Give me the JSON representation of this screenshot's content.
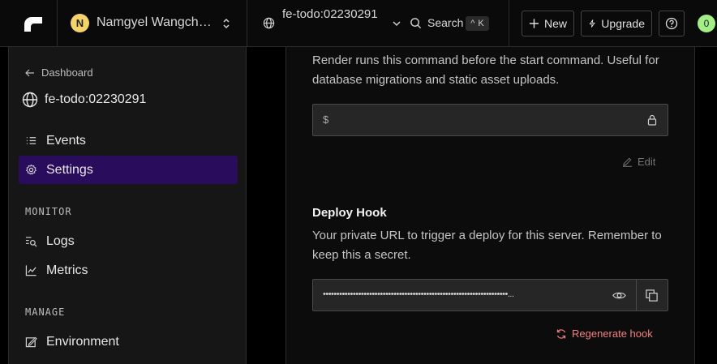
{
  "topbar": {
    "workspace_initial": "N",
    "workspace_name": "Namgyel Wangchu...",
    "project_name": "fe-todo:02230291",
    "search_label": "Search",
    "search_shortcut_mod": "^",
    "search_shortcut_key": "K",
    "new_label": "New",
    "upgrade_label": "Upgrade",
    "notification_count": "0"
  },
  "sidebar": {
    "back_label": "Dashboard",
    "service_name": "fe-todo:02230291",
    "items": [
      {
        "label": "Events",
        "icon": "list-icon",
        "active": false
      },
      {
        "label": "Settings",
        "icon": "gear-icon",
        "active": true
      }
    ],
    "monitor_heading": "MONITOR",
    "monitor_items": [
      {
        "label": "Logs",
        "icon": "logs-search-icon"
      },
      {
        "label": "Metrics",
        "icon": "chart-line-icon"
      }
    ],
    "manage_heading": "MANAGE",
    "manage_items": [
      {
        "label": "Environment",
        "icon": "environment-icon"
      }
    ]
  },
  "main": {
    "pre_deploy": {
      "description": "Render runs this command before the start command. Useful for database migrations and static asset uploads.",
      "prefix": "$",
      "value": "",
      "edit_label": "Edit"
    },
    "deploy_hook": {
      "title": "Deploy Hook",
      "description": "Your private URL to trigger a deploy for this server. Remember to keep this a secret.",
      "masked_value": "••••••••••••••••••••••••••••••••••••••••••••••••••••••••••••••••••••...",
      "regenerate_label": "Regenerate hook"
    }
  },
  "colors": {
    "active_nav_bg": "#2a0c5c",
    "regenerate": "#f08080",
    "avatar": "#f5d36b",
    "badge": "#a3ef86"
  }
}
